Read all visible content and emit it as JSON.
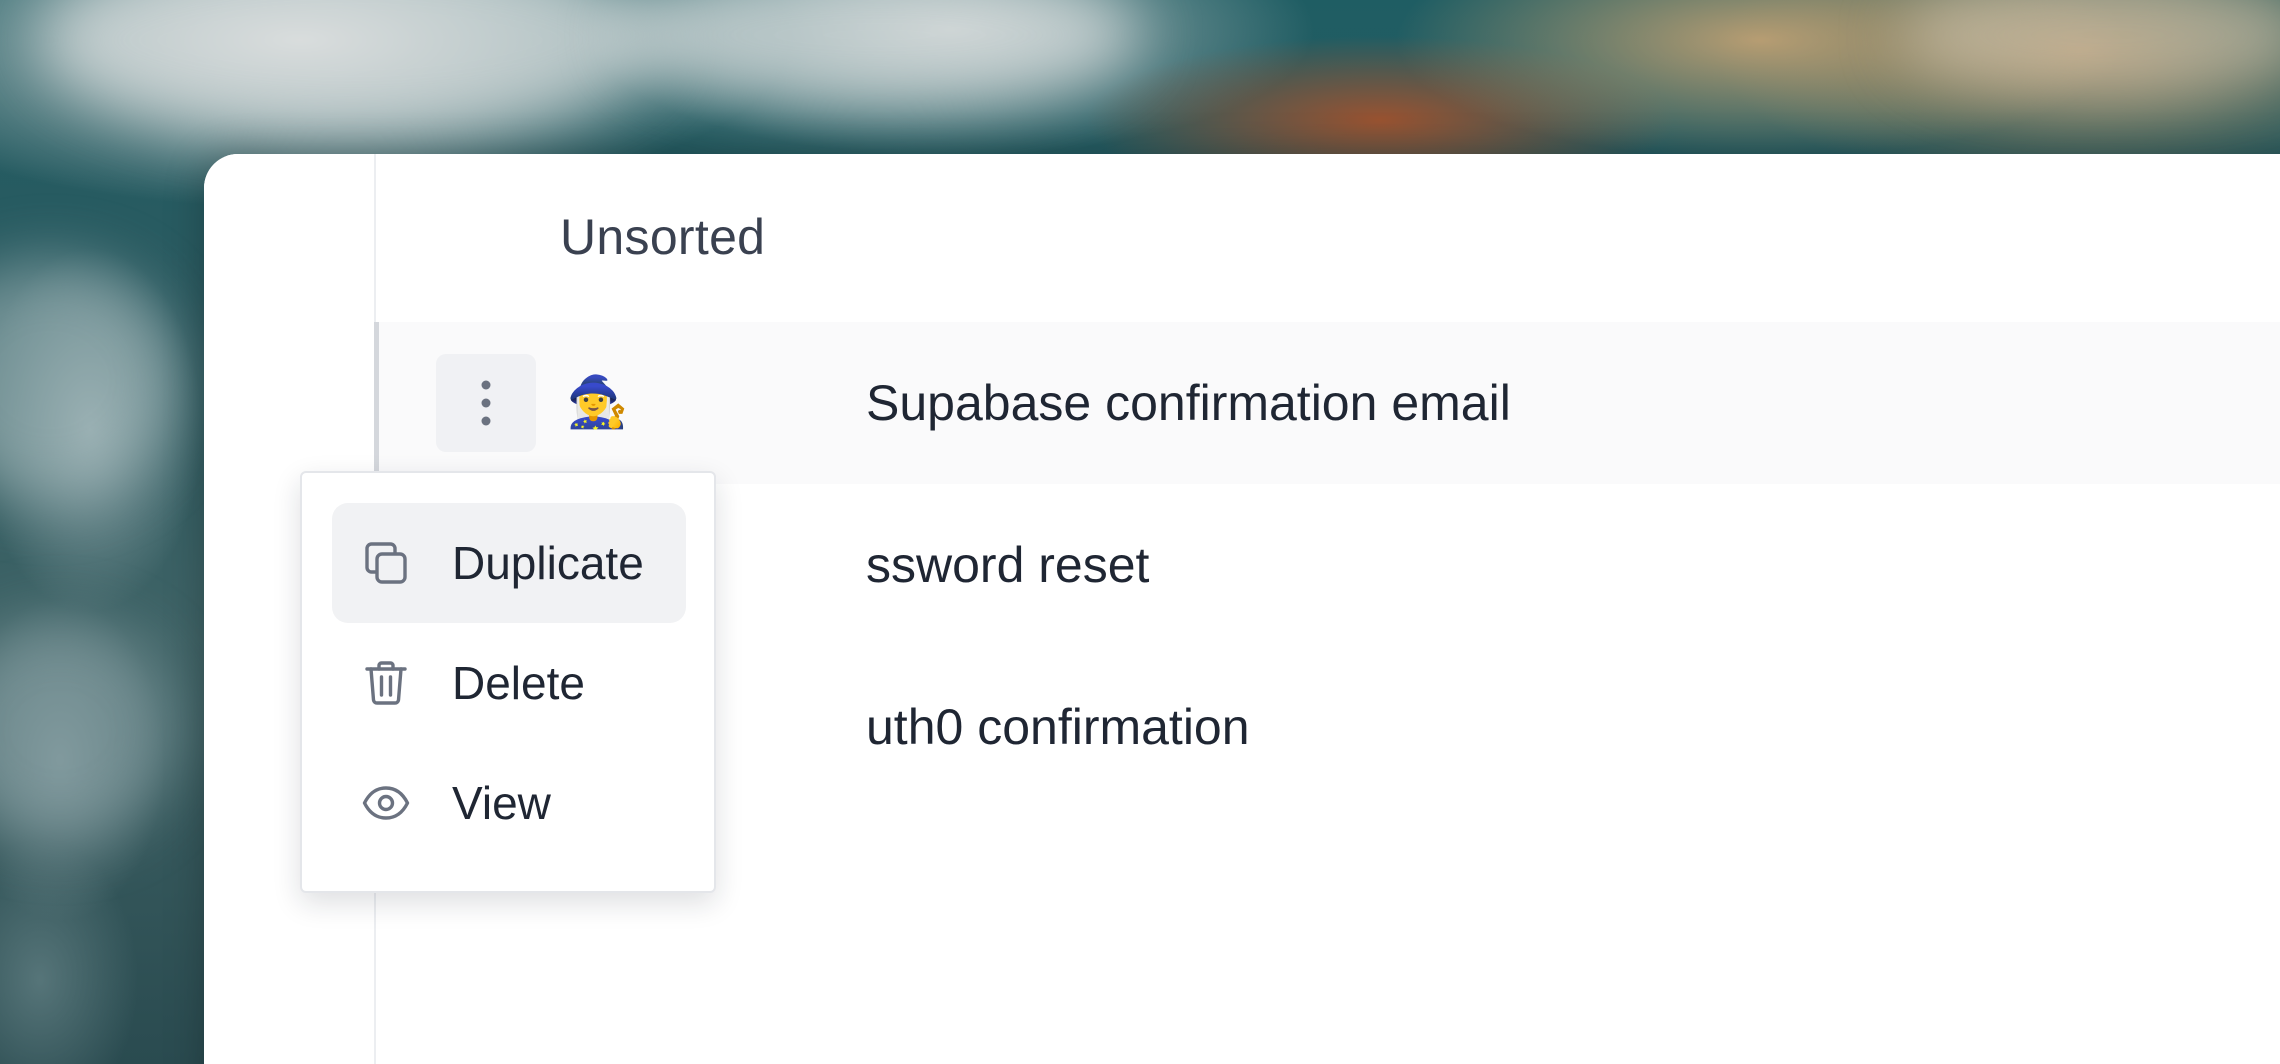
{
  "list": {
    "section_title": "Unsorted",
    "items": [
      {
        "emoji": "🧙‍♀️",
        "title": "Supabase confirmation email",
        "active": true
      },
      {
        "title_visible": "ssword reset"
      },
      {
        "title_visible": "uth0 confirmation"
      }
    ]
  },
  "context_menu": {
    "items": [
      {
        "icon": "duplicate-icon",
        "label": "Duplicate",
        "highlighted": true
      },
      {
        "icon": "trash-icon",
        "label": "Delete"
      },
      {
        "icon": "eye-icon",
        "label": "View"
      }
    ]
  },
  "icons": {
    "more_actions": "kebab-vertical-icon"
  },
  "colors": {
    "text_primary": "#1f2633",
    "text_header": "#3a4150",
    "icon_gray": "#6b7280",
    "hover_bg": "#f1f2f4"
  }
}
